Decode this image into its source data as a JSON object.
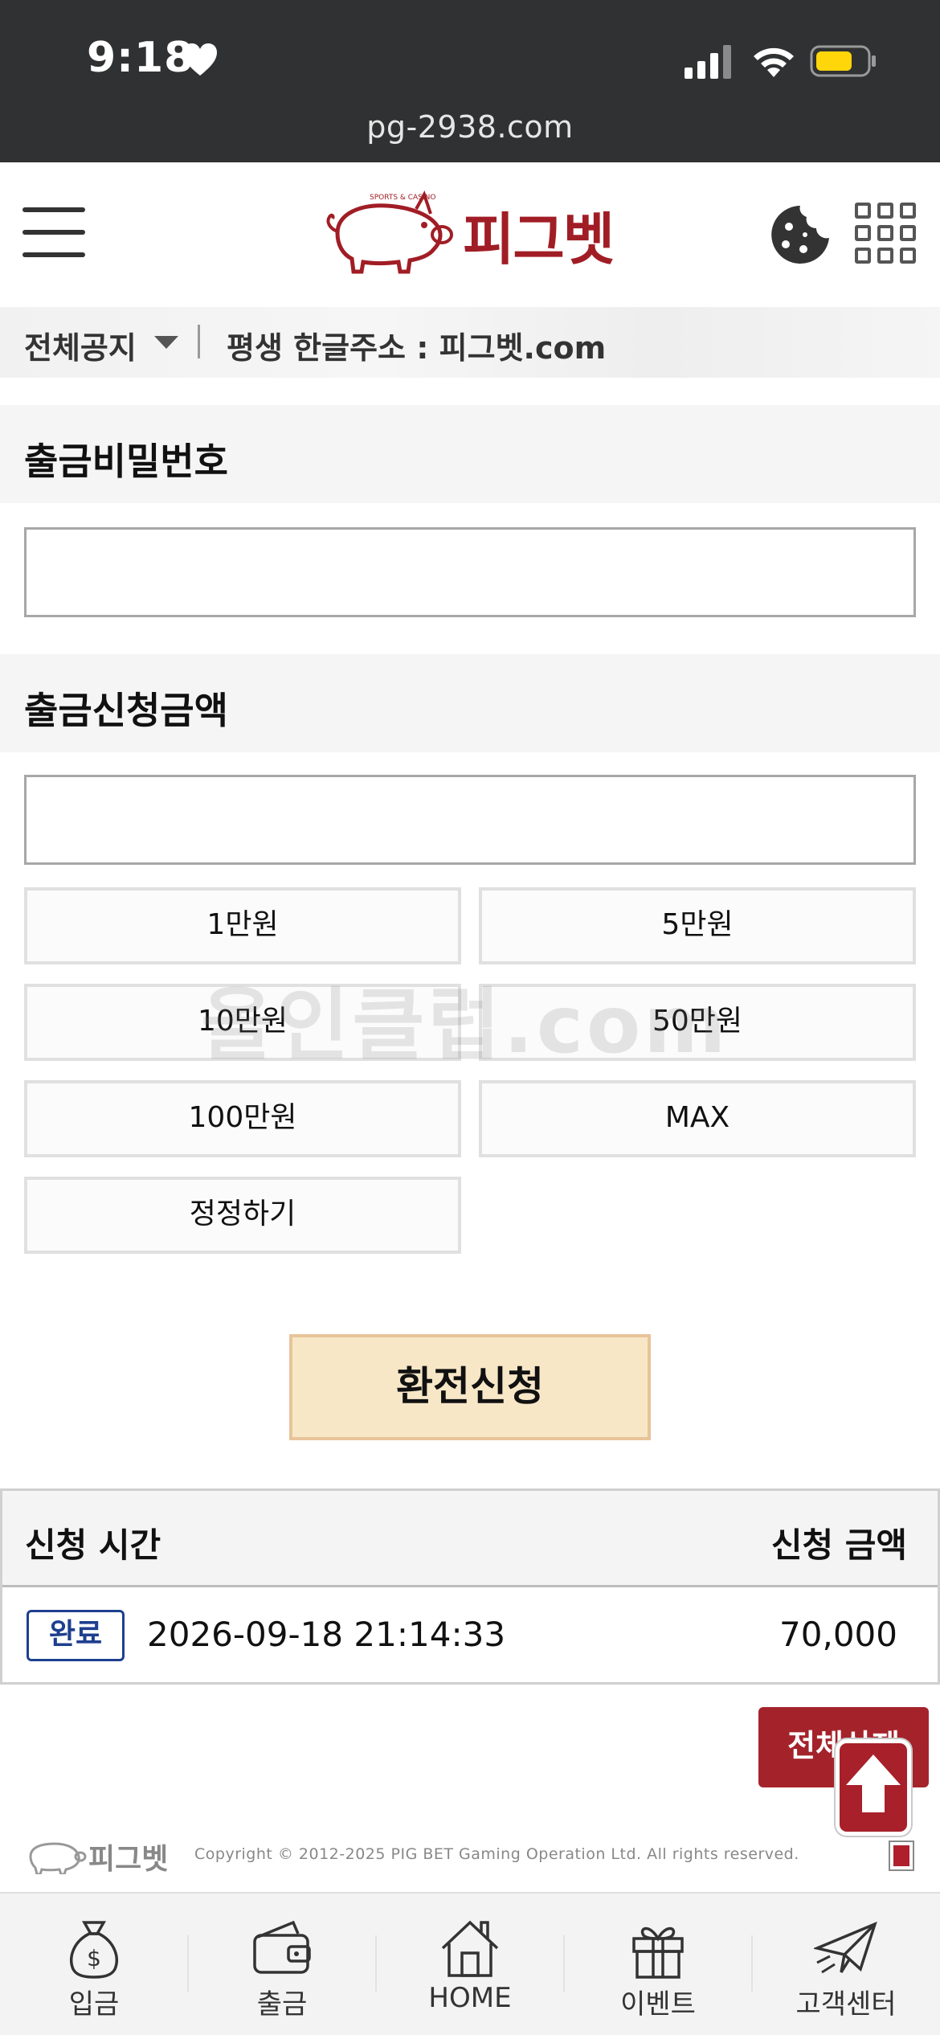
{
  "status_bar": {
    "time": "9:18",
    "url": "pg-2938.com"
  },
  "header": {
    "logo_text": "피그벳",
    "logo_tagline": "SPORTS & CASINO",
    "icons": [
      "menu-icon",
      "cookie-icon",
      "grid-menu-icon"
    ]
  },
  "notice": {
    "category": "전체공지",
    "text": "평생 한글주소 : 피그벳.com"
  },
  "form": {
    "password_label": "출금비밀번호",
    "password_value": "",
    "amount_label": "출금신청금액",
    "amount_value": "",
    "amount_buttons": [
      "1만원",
      "5만원",
      "10만원",
      "50만원",
      "100만원",
      "MAX"
    ],
    "reset_label": "정정하기",
    "submit_label": "환전신청",
    "watermark": "올인클럽.com"
  },
  "history": {
    "headers": {
      "time": "신청 시간",
      "amount": "신청 금액"
    },
    "rows": [
      {
        "status": "완료",
        "time": "2026-09-18 21:14:33",
        "amount": "70,000"
      }
    ],
    "delete_all_label": "전체삭제"
  },
  "footer": {
    "logo_text": "피그벳",
    "copyright": "Copyright © 2012-2025 PIG BET Gaming Operation Ltd. All rights reserved."
  },
  "bottom_nav": [
    {
      "label": "입금",
      "icon": "money-bag-icon"
    },
    {
      "label": "출금",
      "icon": "wallet-icon"
    },
    {
      "label": "HOME",
      "icon": "home-icon"
    },
    {
      "label": "이벤트",
      "icon": "gift-icon"
    },
    {
      "label": "고객센터",
      "icon": "paper-plane-icon"
    }
  ],
  "colors": {
    "brand_red": "#a11d25",
    "submit_bg": "#f7e7c7",
    "badge_blue": "#1e3f8f",
    "statusbar_bg": "#303132"
  }
}
